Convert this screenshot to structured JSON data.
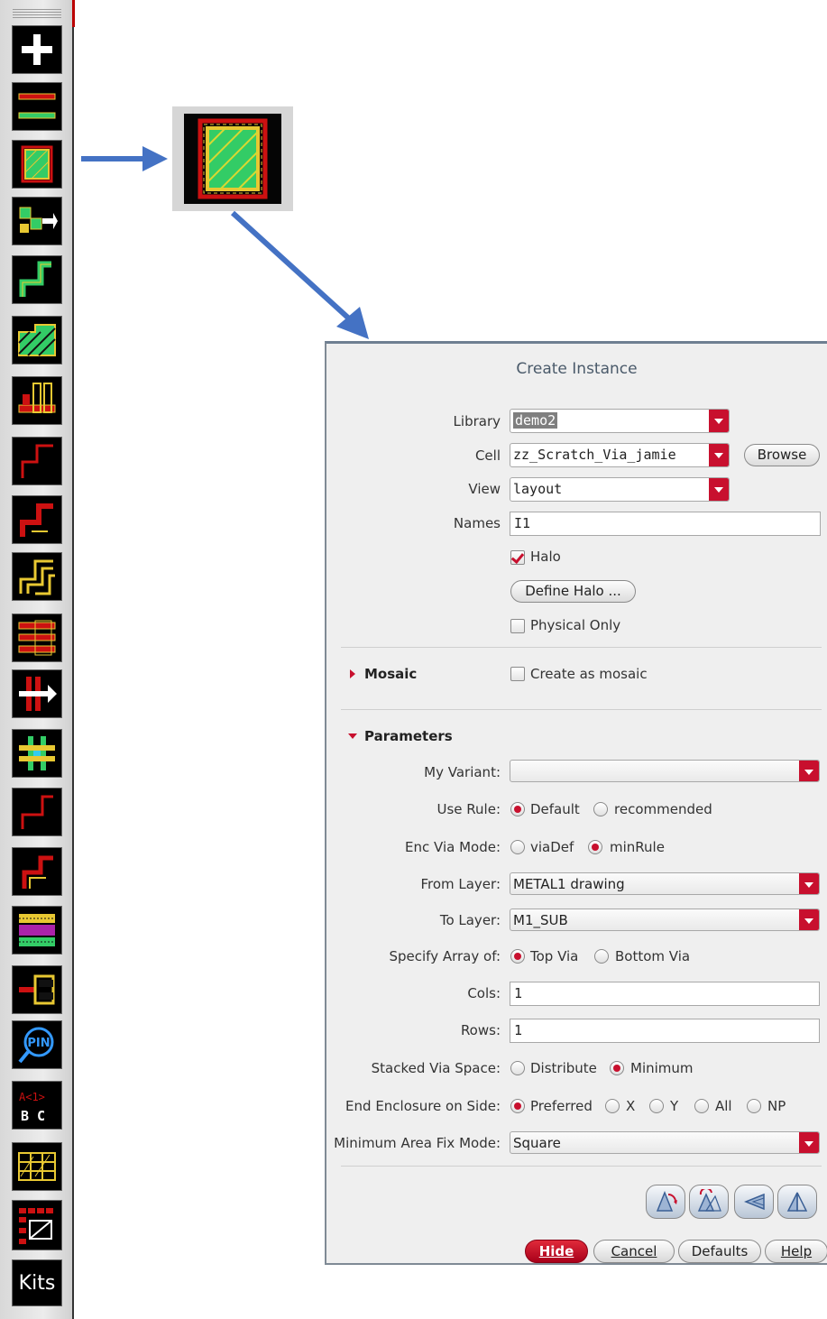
{
  "toolbar": {
    "icons": [
      "create-instance-plus-icon",
      "create-path-icon",
      "create-instance-icon",
      "move-cell-icon",
      "create-wire-icon",
      "create-polygon-icon",
      "create-bus-icon",
      "create-step-wire-icon",
      "create-step-wire-red-icon",
      "create-multi-wire-icon",
      "create-array-icon",
      "stretch-arrow-icon",
      "create-crossing-icon",
      "create-corner-icon",
      "create-corner-red-icon",
      "create-guard-ring-icon",
      "create-contact-icon",
      "create-pin-icon",
      "create-label-icon",
      "create-grid-icon",
      "create-pattern-icon",
      "kits-icon"
    ],
    "kits_label": "Kits"
  },
  "dialog": {
    "title": "Create Instance",
    "library": {
      "label": "Library",
      "value": "demo2"
    },
    "cell": {
      "label": "Cell",
      "value": "zz_Scratch_Via_jamie",
      "browse_label": "Browse"
    },
    "view": {
      "label": "View",
      "value": "layout"
    },
    "names": {
      "label": "Names",
      "value": "I1"
    },
    "halo": {
      "label": "Halo",
      "checked": true
    },
    "define_halo_label": "Define Halo ...",
    "physical_only": {
      "label": "Physical Only",
      "checked": false
    },
    "mosaic": {
      "label": "Mosaic",
      "checkbox_label": "Create as mosaic",
      "checked": false
    },
    "parameters": {
      "label": "Parameters",
      "my_variant": {
        "label": "My Variant:",
        "value": ""
      },
      "use_rule": {
        "label": "Use Rule:",
        "options": [
          "Default",
          "recommended"
        ],
        "selected": "Default"
      },
      "enc_via_mode": {
        "label": "Enc Via Mode:",
        "options": [
          "viaDef",
          "minRule"
        ],
        "selected": "minRule"
      },
      "from_layer": {
        "label": "From Layer:",
        "value": "METAL1 drawing"
      },
      "to_layer": {
        "label": "To Layer:",
        "value": "M1_SUB"
      },
      "specify_array": {
        "label": "Specify Array of:",
        "options": [
          "Top Via",
          "Bottom Via"
        ],
        "selected": "Top Via"
      },
      "cols": {
        "label": "Cols:",
        "value": "1"
      },
      "rows": {
        "label": "Rows:",
        "value": "1"
      },
      "stacked_via_space": {
        "label": "Stacked Via Space:",
        "options": [
          "Distribute",
          "Minimum"
        ],
        "selected": "Minimum"
      },
      "end_enclosure": {
        "label": "End Enclosure on Side:",
        "options": [
          "Preferred",
          "X",
          "Y",
          "All",
          "NP"
        ],
        "selected": "Preferred"
      },
      "min_area_fix": {
        "label": "Minimum Area Fix Mode:",
        "value": "Square"
      }
    },
    "buttons": {
      "hide": "Hide",
      "cancel": "Cancel",
      "defaults": "Defaults",
      "help": "Help"
    },
    "transform_icons": [
      "rotate-icon",
      "sideways-icon",
      "flip-left-icon",
      "upside-down-icon"
    ]
  },
  "colors": {
    "accent": "#c8102e",
    "arrow": "#4472c4",
    "icon_yellow": "#e8c832",
    "icon_green": "#33cc66"
  }
}
